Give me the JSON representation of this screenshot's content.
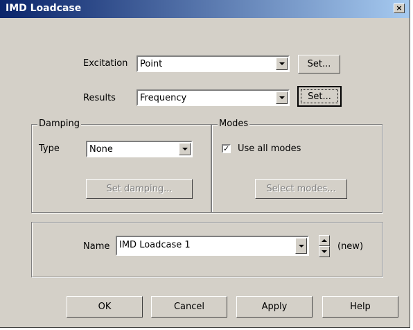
{
  "window": {
    "title": "IMD Loadcase",
    "close_glyph": "×"
  },
  "excitation": {
    "label": "Excitation",
    "value": "Point",
    "set_label": "Set..."
  },
  "results": {
    "label": "Results",
    "value": "Frequency",
    "set_label": "Set..."
  },
  "damping": {
    "group_label": "Damping",
    "type_label": "Type",
    "type_value": "None",
    "set_damping_label": "Set damping..."
  },
  "modes": {
    "group_label": "Modes",
    "use_all_label": "Use all modes",
    "use_all_checked": true,
    "check_glyph": "✓",
    "select_modes_label": "Select modes..."
  },
  "name": {
    "label": "Name",
    "value": "IMD Loadcase 1",
    "status": "(new)"
  },
  "buttons": {
    "ok": "OK",
    "cancel": "Cancel",
    "apply": "Apply",
    "help": "Help"
  },
  "colors": {
    "face": "#d4d0c8",
    "title_start": "#0a246a",
    "title_end": "#a6caf0",
    "disabled_text": "#808080"
  }
}
